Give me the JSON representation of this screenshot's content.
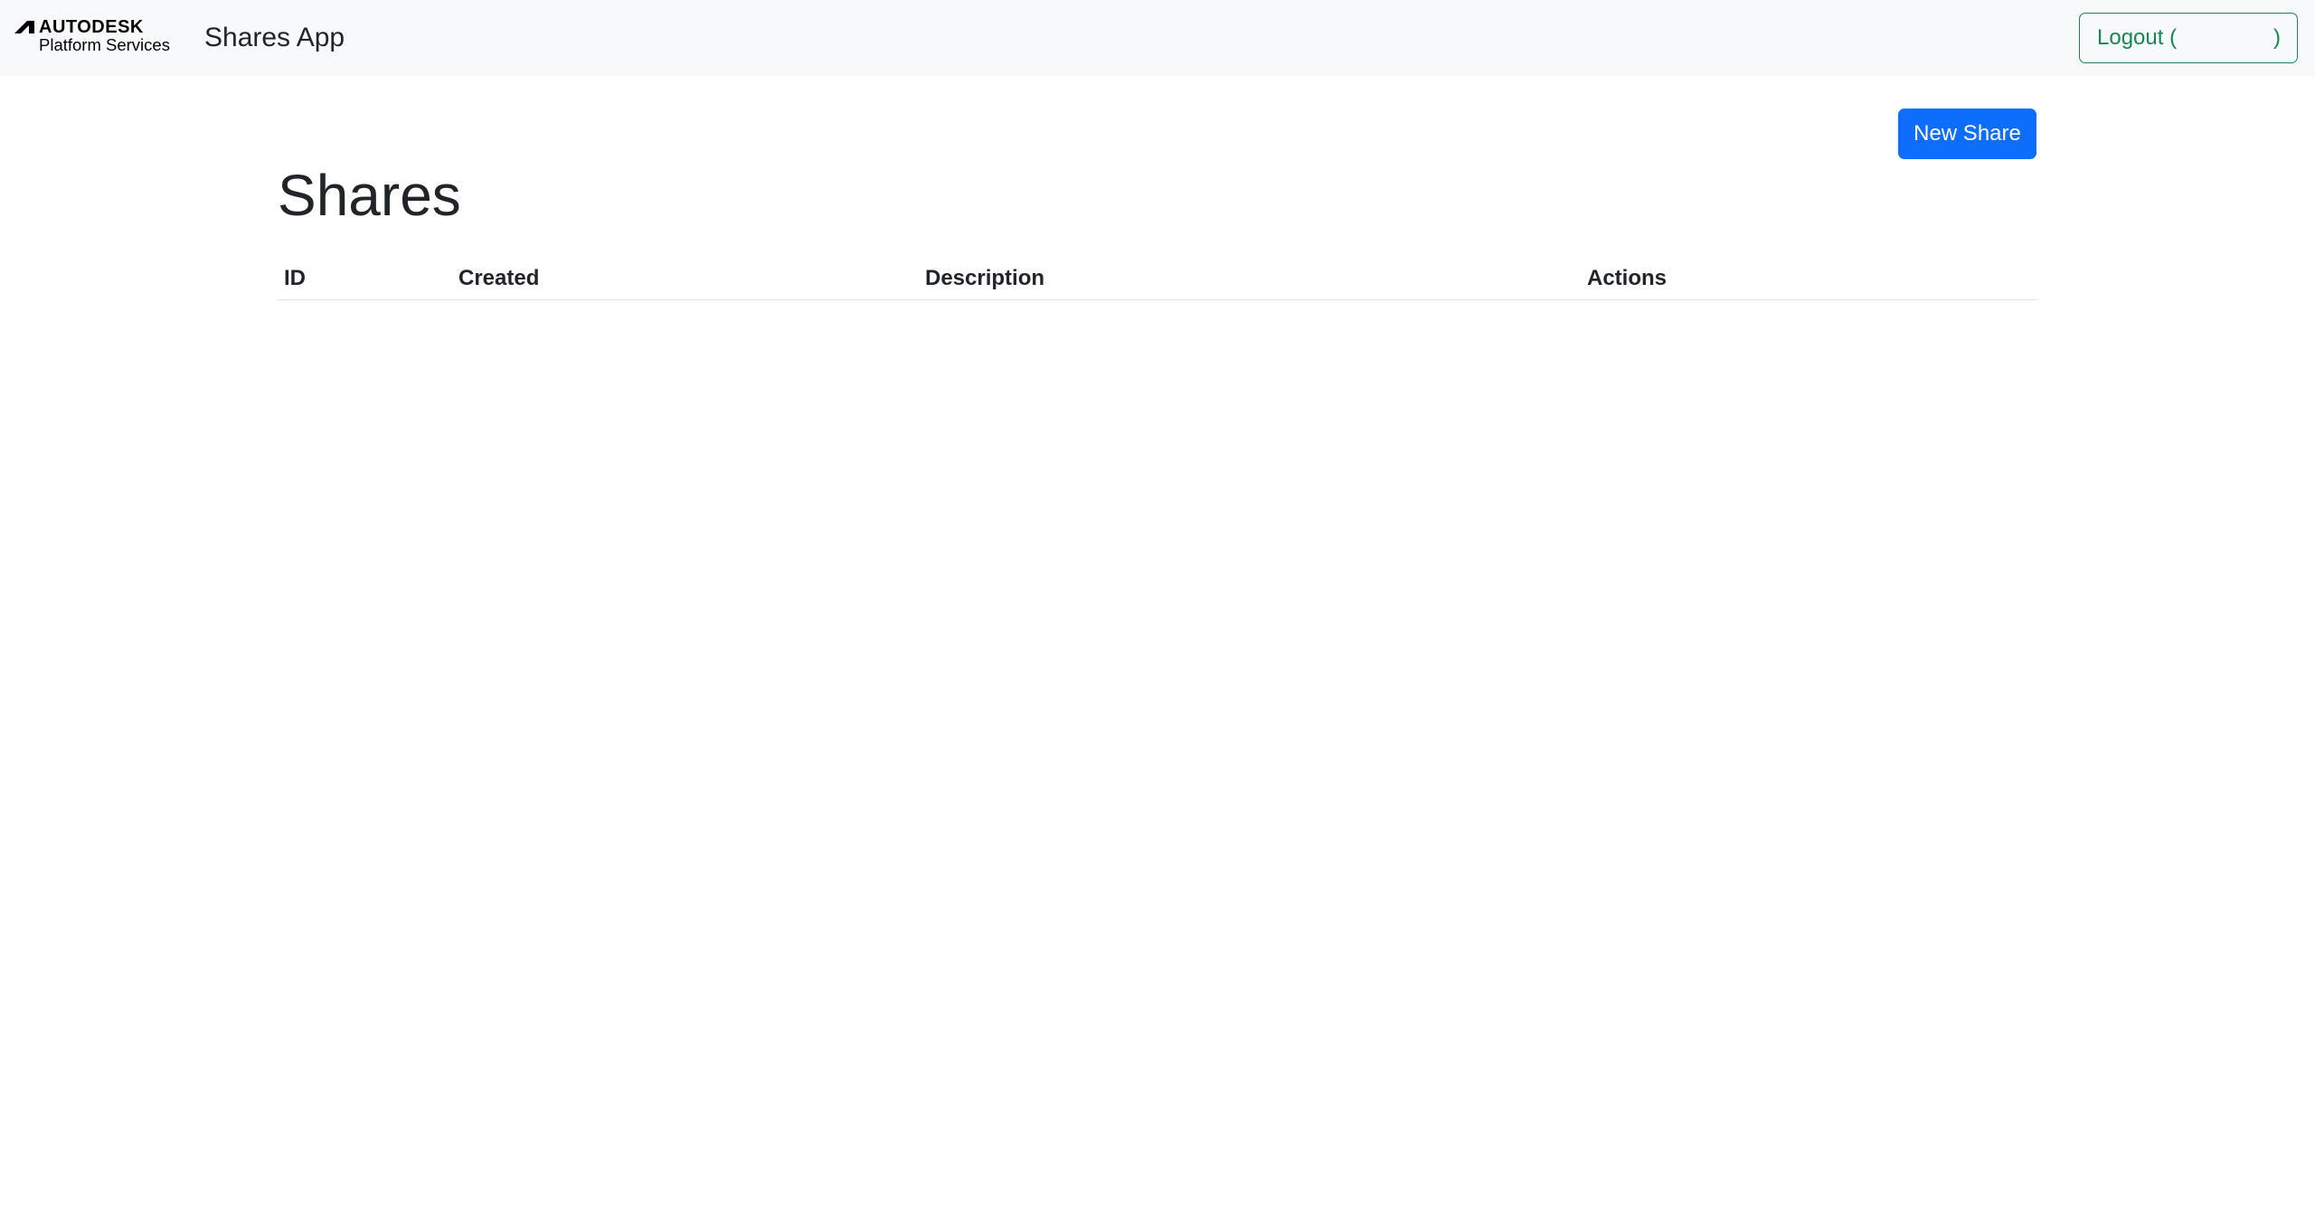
{
  "navbar": {
    "logo_top": "AUTODESK",
    "logo_bottom": "Platform Services",
    "app_title": "Shares App",
    "logout_label": "Logout (",
    "logout_close": ")"
  },
  "main": {
    "new_share_label": "New Share",
    "page_title": "Shares",
    "table": {
      "columns": [
        "ID",
        "Created",
        "Description",
        "Actions"
      ],
      "rows": []
    }
  },
  "colors": {
    "primary": "#0d6efd",
    "success": "#198754",
    "navbar_bg": "#f8f9fa",
    "text": "#212529"
  },
  "icons": {
    "brand": "autodesk-logo-icon"
  }
}
